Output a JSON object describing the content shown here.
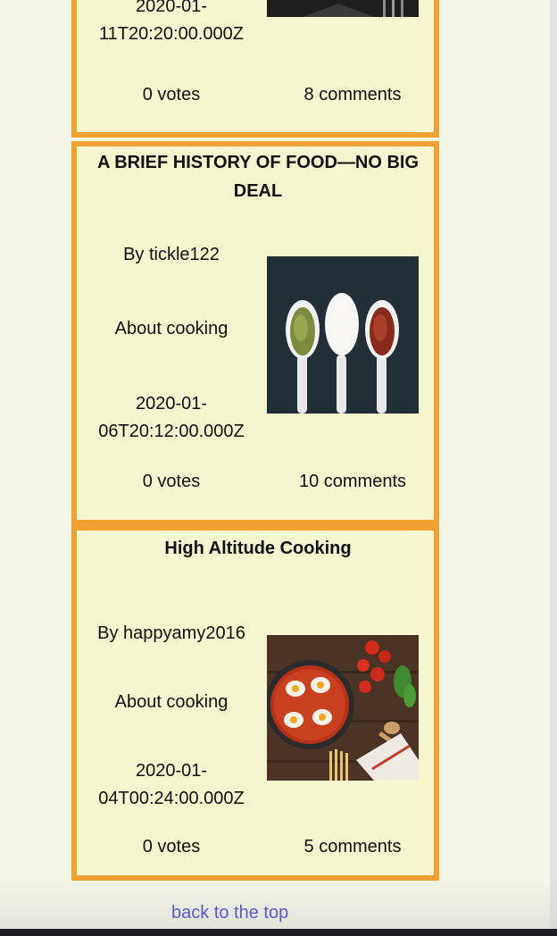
{
  "posts": [
    {
      "title": "",
      "author": "",
      "topic": "",
      "date_part1": "2020-01-",
      "date_part2": "11T20:20:00.000Z",
      "votes": "0 votes",
      "comments": "8 comments"
    },
    {
      "title": "A BRIEF HISTORY OF FOOD—NO BIG DEAL",
      "author": "By tickle122",
      "topic": "About cooking",
      "date_part1": "2020-01-",
      "date_part2": "06T20:12:00.000Z",
      "votes": "0 votes",
      "comments": "10 comments"
    },
    {
      "title": "High Altitude Cooking",
      "author": "By happyamy2016",
      "topic": "About cooking",
      "date_part1": "2020-01-",
      "date_part2": "04T00:24:00.000Z",
      "votes": "0 votes",
      "comments": "5 comments"
    }
  ],
  "footer": {
    "back_to_top": "back to the top"
  },
  "colors": {
    "card_bg": "#f5f5cf",
    "card_border": "#f0a131",
    "page_bg": "#f4f5e7",
    "link": "#5a5ad6"
  },
  "icons": {
    "post_1_image": "food-photo",
    "post_2_image": "spice-spoons-photo",
    "post_3_image": "shakshuka-pan-photo"
  }
}
